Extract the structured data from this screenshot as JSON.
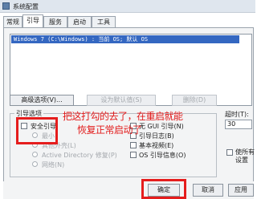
{
  "window": {
    "title": "系统配置"
  },
  "tabs": [
    {
      "label": "常规",
      "active": false
    },
    {
      "label": "引导",
      "active": true
    },
    {
      "label": "服务",
      "active": false
    },
    {
      "label": "启动",
      "active": false
    },
    {
      "label": "工具",
      "active": false
    }
  ],
  "os_list": {
    "entries": [
      "Windows 7 (C:\\Windows) : 当前 OS; 默认 OS"
    ]
  },
  "os_buttons": {
    "advanced": "高级选项(V)...",
    "set_default": "设为默认值(S)",
    "delete": "删除(D)"
  },
  "boot_options": {
    "group_label": "引导选项",
    "safe_boot": "安全引导",
    "minimal": "最小",
    "other_shell": "其他外壳(L)",
    "active_directory": "Active Directory 修复(P)",
    "network": "网络(N)",
    "no_gui": "无 GUI 引导(N)",
    "boot_log": "引导日志(B)",
    "base_video": "基本视频(E)",
    "os_info": "OS 引导信息(O)"
  },
  "timeout": {
    "label": "超时(T):",
    "value": "30"
  },
  "permanent": {
    "line1": "使所有",
    "line2": "设置"
  },
  "annotation": {
    "line1": "把这打勾的去了，在重启就能",
    "line2": "恢复正常启动了"
  },
  "footer": {
    "ok": "确定",
    "cancel": "取消",
    "apply": "应用"
  },
  "colors": {
    "annotation_red": "#e21b1b",
    "selection_blue": "#3467c1"
  }
}
